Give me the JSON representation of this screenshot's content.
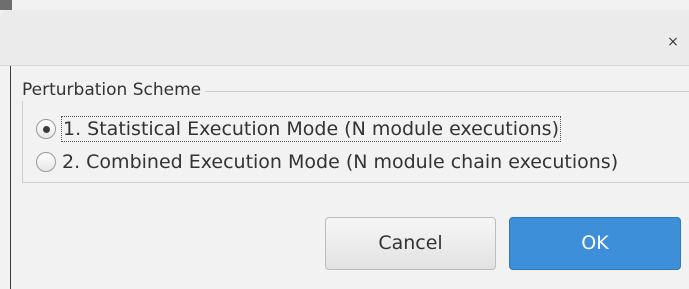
{
  "window": {
    "close_glyph": "×"
  },
  "group": {
    "title": "Perturbation Scheme",
    "options": [
      {
        "label": "1. Statistical Execution Mode (N module executions)",
        "checked": true
      },
      {
        "label": "2. Combined Execution Mode (N module chain executions)",
        "checked": false
      }
    ]
  },
  "buttons": {
    "cancel_label": "Cancel",
    "ok_label": "OK"
  },
  "colors": {
    "ok_button": "#3d8fd9",
    "dialog_background": "#f2f2f2"
  }
}
